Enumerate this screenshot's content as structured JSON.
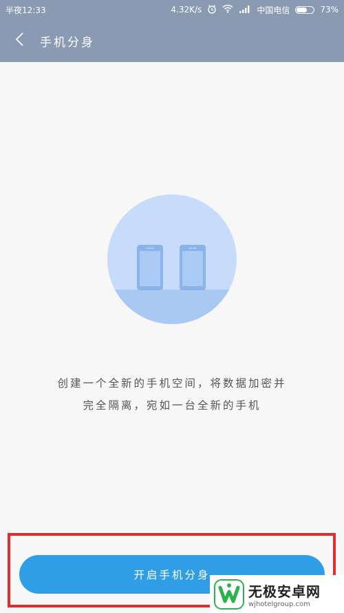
{
  "status_bar": {
    "time": "半夜12:33",
    "network_speed": "4.32K/s",
    "carrier": "中国电信",
    "battery": "73%",
    "battery_level": 0.73,
    "icons": [
      "alarm-icon",
      "wifi-icon",
      "signal-icon",
      "battery-icon"
    ]
  },
  "header": {
    "title": "手机分身",
    "back_icon": "chevron-left-icon"
  },
  "main": {
    "description_line1": "创建一个全新的手机空间，将数据加密并",
    "description_line2": "完全隔离，宛如一台全新的手机",
    "illustration": "two-phones-illustration"
  },
  "actions": {
    "start_label": "开启手机分身"
  },
  "watermark": {
    "brand": "无极安卓网",
    "url": "wjhotelgroup.com"
  },
  "colors": {
    "header_bg": "#8a9ab2",
    "page_bg": "#f7f7f7",
    "button_bg": "#2f9ee6",
    "highlight_border": "#e52b2b",
    "illustration_circle": "#c7dcfa",
    "watermark_green": "#2bb24c"
  }
}
